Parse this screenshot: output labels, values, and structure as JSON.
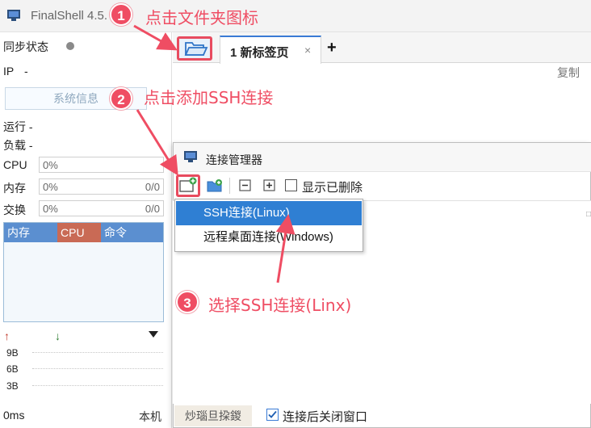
{
  "titlebar": {
    "app_title": "FinalShell 4.5."
  },
  "left_panel": {
    "sync_label": "同步状态",
    "ip_label": "IP",
    "ip_value": "-",
    "copy_label": "复制",
    "sysinfo_button": "系统信息",
    "uptime_label": "运行 -",
    "load_label": "负载 -",
    "cpu_label": "CPU",
    "cpu_value": "0%",
    "mem_label": "内存",
    "mem_value": "0%",
    "mem_extra": "0/0",
    "swap_label": "交换",
    "swap_value": "0%",
    "swap_extra": "0/0",
    "process_columns": [
      "内存",
      "CPU",
      "命令"
    ],
    "net_scale": [
      "9B",
      "6B",
      "3B"
    ],
    "ping_label": "0ms",
    "local_label": "本机"
  },
  "tabbar": {
    "tab_label": "1 新标签页",
    "tab_close": "×",
    "add_tab": "+"
  },
  "dialog": {
    "title": "连接管理器",
    "show_deleted_label": "显示已删除",
    "status_tab_label": "炒瑙旦挅鍐",
    "close_after_connect_label": "连接后关闭窗口",
    "close_after_connect_checked": true
  },
  "dropdown": {
    "items": [
      "SSH连接(Linux)",
      "远程桌面连接(Windows)"
    ],
    "selected_index": 0
  },
  "annotations": {
    "step1": {
      "number": "1",
      "text": "点击文件夹图标"
    },
    "step2": {
      "number": "2",
      "text": "点击添加SSH连接"
    },
    "step3": {
      "number": "3",
      "text": "选择SSH连接(Linx)"
    }
  },
  "colors": {
    "accent_red": "#ef4d63",
    "selection_blue": "#2f7fd3",
    "tab_blue": "#3a7bd5",
    "cpu_column": "#c96a55",
    "mem_column": "#5b8fd0"
  }
}
